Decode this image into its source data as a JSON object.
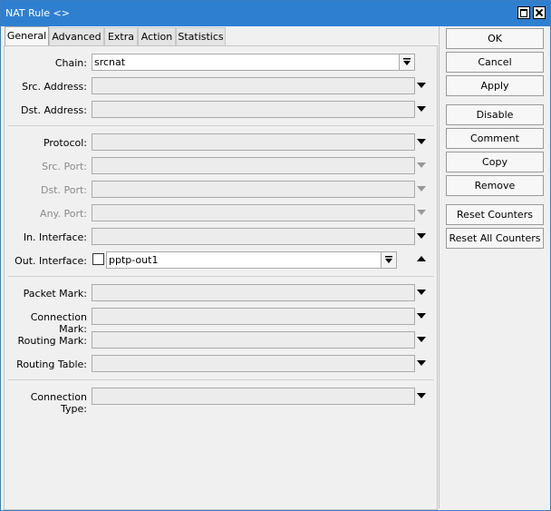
{
  "window": {
    "title": "NAT Rule <>"
  },
  "tabs": [
    {
      "label": "General"
    },
    {
      "label": "Advanced"
    },
    {
      "label": "Extra"
    },
    {
      "label": "Action"
    },
    {
      "label": "Statistics"
    }
  ],
  "fields": {
    "chain": {
      "label": "Chain:",
      "value": "srcnat"
    },
    "src_address": {
      "label": "Src. Address:"
    },
    "dst_address": {
      "label": "Dst. Address:"
    },
    "protocol": {
      "label": "Protocol:"
    },
    "src_port": {
      "label": "Src. Port:"
    },
    "dst_port": {
      "label": "Dst. Port:"
    },
    "any_port": {
      "label": "Any. Port:"
    },
    "in_interface": {
      "label": "In. Interface:"
    },
    "out_interface": {
      "label": "Out. Interface:",
      "value": "pptp-out1"
    },
    "packet_mark": {
      "label": "Packet Mark:"
    },
    "connection_mark": {
      "label": "Connection Mark:"
    },
    "routing_mark": {
      "label": "Routing Mark:"
    },
    "routing_table": {
      "label": "Routing Table:"
    },
    "connection_type": {
      "label": "Connection Type:"
    }
  },
  "buttons": {
    "ok": "OK",
    "cancel": "Cancel",
    "apply": "Apply",
    "disable": "Disable",
    "comment": "Comment",
    "copy": "Copy",
    "remove": "Remove",
    "reset_counters": "Reset Counters",
    "reset_all_counters": "Reset All Counters"
  }
}
